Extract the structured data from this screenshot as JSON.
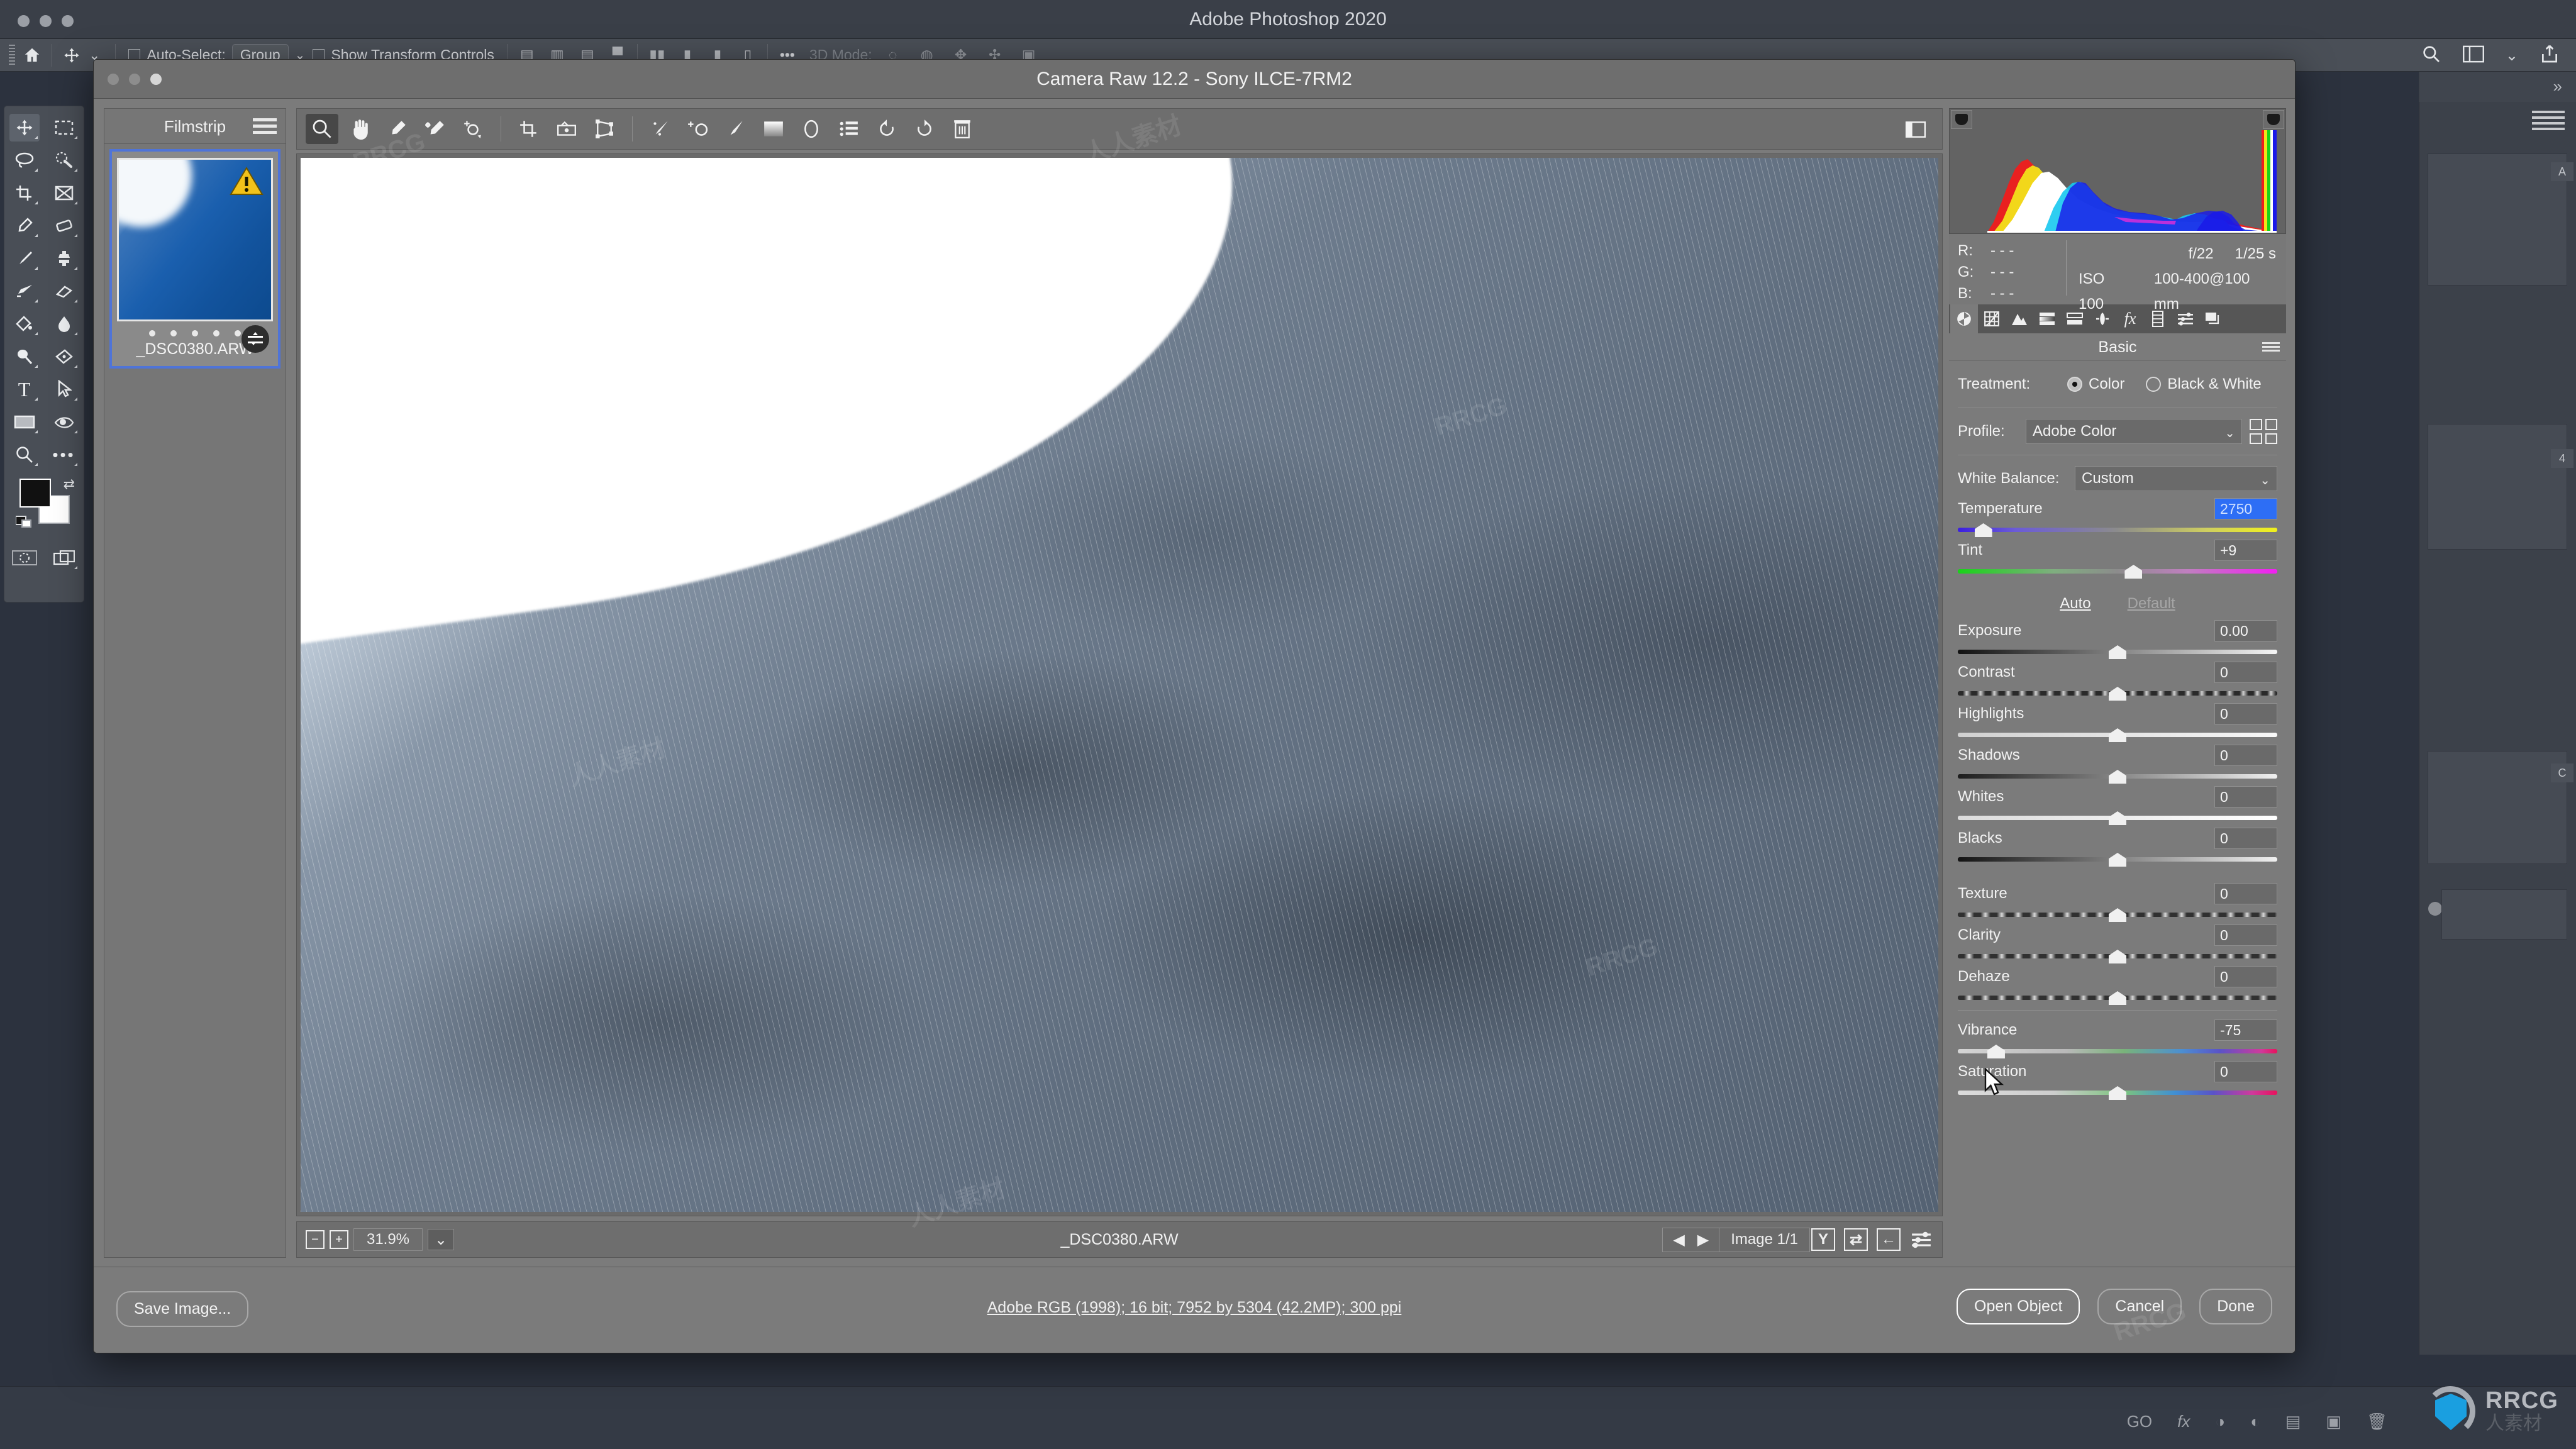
{
  "photoshop": {
    "app_title": "Adobe Photoshop 2020",
    "options_bar": {
      "home_icon": "home-icon",
      "move_tool_icon": "move-tool-icon",
      "auto_select_label": "Auto-Select:",
      "auto_select_value": "Group",
      "show_transform_label": "Show Transform Controls",
      "three_d_mode_label": "3D Mode:",
      "search_icon": "search-icon",
      "workspace_icon": "workspace-icon",
      "share_icon": "share-icon"
    },
    "toolbar": [
      {
        "icon": "move-tool-icon",
        "selected": true
      },
      {
        "icon": "marquee-tool-icon",
        "selected": false
      },
      {
        "icon": "lasso-tool-icon",
        "selected": false
      },
      {
        "icon": "quick-selection-tool-icon",
        "selected": false
      },
      {
        "icon": "crop-tool-icon",
        "selected": false
      },
      {
        "icon": "frame-tool-icon",
        "selected": false
      },
      {
        "icon": "eyedropper-tool-icon",
        "selected": false
      },
      {
        "icon": "healing-brush-tool-icon",
        "selected": false
      },
      {
        "icon": "brush-tool-icon",
        "selected": false
      },
      {
        "icon": "clone-stamp-tool-icon",
        "selected": false
      },
      {
        "icon": "history-brush-tool-icon",
        "selected": false
      },
      {
        "icon": "eraser-tool-icon",
        "selected": false
      },
      {
        "icon": "gradient-tool-icon",
        "selected": false
      },
      {
        "icon": "blur-tool-icon",
        "selected": false
      },
      {
        "icon": "dodge-tool-icon",
        "selected": false
      },
      {
        "icon": "pen-tool-icon",
        "selected": false
      },
      {
        "icon": "type-tool-icon",
        "selected": false
      },
      {
        "icon": "path-selection-tool-icon",
        "selected": false
      },
      {
        "icon": "rectangle-tool-icon",
        "selected": false
      },
      {
        "icon": "hand-tool-icon",
        "selected": false
      },
      {
        "icon": "zoom-tool-icon",
        "selected": false
      },
      {
        "icon": "edit-toolbar-icon",
        "selected": false
      },
      {
        "icon": "quick-mask-icon",
        "selected": false
      },
      {
        "icon": "screen-mode-icon",
        "selected": false
      }
    ],
    "watermark": {
      "brand": "RRCG",
      "sub": "人素材"
    }
  },
  "camera_raw": {
    "title": "Camera Raw 12.2  -  Sony ILCE-7RM2",
    "filmstrip": {
      "header": "Filmstrip",
      "menu_icon": "hamburger-menu-icon",
      "items": [
        {
          "filename": "_DSC0380.ARW",
          "warning_icon": "warning-triangle-icon",
          "badge_icon": "adjustments-badge-icon",
          "selected": true
        }
      ]
    },
    "toolbar": [
      {
        "name": "zoom-tool",
        "icon": "magnifier-icon",
        "selected": true
      },
      {
        "name": "hand-tool",
        "icon": "hand-icon",
        "selected": false
      },
      {
        "name": "white-balance-tool",
        "icon": "eyedropper-icon",
        "selected": false
      },
      {
        "name": "color-sampler-tool",
        "icon": "color-sampler-icon",
        "selected": false
      },
      {
        "name": "targeted-adjustment-tool",
        "icon": "target-adjust-icon",
        "selected": false
      },
      {
        "name": "crop-tool",
        "icon": "crop-icon",
        "selected": false
      },
      {
        "name": "straighten-tool",
        "icon": "straighten-icon",
        "selected": false
      },
      {
        "name": "transform-tool",
        "icon": "transform-icon",
        "selected": false
      },
      {
        "name": "spot-removal-tool",
        "icon": "spot-removal-icon",
        "selected": false
      },
      {
        "name": "red-eye-tool",
        "icon": "red-eye-icon",
        "selected": false
      },
      {
        "name": "adjustment-brush-tool",
        "icon": "adjustment-brush-icon",
        "selected": false
      },
      {
        "name": "graduated-filter-tool",
        "icon": "graduated-filter-icon",
        "selected": false
      },
      {
        "name": "radial-filter-tool",
        "icon": "radial-filter-icon",
        "selected": false
      },
      {
        "name": "presets-tool",
        "icon": "presets-list-icon",
        "selected": false
      },
      {
        "name": "rotate-ccw-tool",
        "icon": "rotate-counterclockwise-icon",
        "selected": false
      },
      {
        "name": "rotate-cw-tool",
        "icon": "rotate-clockwise-icon",
        "selected": false
      },
      {
        "name": "delete-tool",
        "icon": "trash-icon",
        "selected": false
      }
    ],
    "toolbar_right_icon": "fullscreen-toggle-icon",
    "status_bar": {
      "zoom_out_label": "−",
      "zoom_in_label": "+",
      "zoom_value": "31.9%",
      "zoom_caret_icon": "chevron-down-icon",
      "filename": "_DSC0380.ARW",
      "prev_icon": "prev-arrow-icon",
      "next_icon": "next-arrow-icon",
      "image_counter": "Image 1/1",
      "icons": [
        {
          "name": "before-after-icon",
          "glyph": "Y"
        },
        {
          "name": "swap-before-after-icon",
          "glyph": "⇄"
        },
        {
          "name": "copy-settings-icon",
          "glyph": "←"
        },
        {
          "name": "preview-preferences-icon",
          "glyph": "sliders"
        }
      ]
    },
    "histogram": {
      "shadow_clip_icon": "shadow-clipping-icon",
      "highlight_clip_icon": "highlight-clipping-icon"
    },
    "exif": {
      "r_label": "R:",
      "r_value": "- - -",
      "g_label": "G:",
      "g_value": "- - -",
      "b_label": "B:",
      "b_value": "- - -",
      "aperture": "f/22",
      "shutter": "1/25 s",
      "iso": "ISO 100",
      "lens": "100-400@100 mm"
    },
    "panel_tabs": [
      {
        "name": "basic-tab",
        "icon": "aperture-icon",
        "selected": true
      },
      {
        "name": "tone-curve-tab",
        "icon": "curve-grid-icon",
        "selected": false
      },
      {
        "name": "detail-tab",
        "icon": "mountains-icon",
        "selected": false
      },
      {
        "name": "color-mixer-tab",
        "icon": "gradient-bars-icon",
        "selected": false
      },
      {
        "name": "color-grading-tab",
        "icon": "split-tone-icon",
        "selected": false
      },
      {
        "name": "optics-tab",
        "icon": "lens-icon",
        "selected": false
      },
      {
        "name": "effects-tab",
        "icon": "fx-icon",
        "selected": false
      },
      {
        "name": "calibration-tab",
        "icon": "filmstrip-icon",
        "selected": false
      },
      {
        "name": "presets-tab",
        "icon": "sliders-icon",
        "selected": false
      },
      {
        "name": "snapshots-tab",
        "icon": "stacked-layers-icon",
        "selected": false
      }
    ],
    "panel_title": "Basic",
    "panel_menu_icon": "panel-menu-icon",
    "basic": {
      "treatment_label": "Treatment:",
      "treatment_options": [
        {
          "label": "Color",
          "selected": true
        },
        {
          "label": "Black & White",
          "selected": false
        }
      ],
      "profile_label": "Profile:",
      "profile_value": "Adobe Color",
      "profile_browse_icon": "profile-browser-icon",
      "white_balance_label": "White Balance:",
      "white_balance_value": "Custom",
      "auto_label": "Auto",
      "default_label": "Default",
      "sliders": [
        {
          "name": "Temperature",
          "value": "2750",
          "pos": 8,
          "bar": "temp",
          "selected": true
        },
        {
          "name": "Tint",
          "value": "+9",
          "pos": 55,
          "bar": "tint",
          "selected": false
        },
        {
          "name": "Exposure",
          "value": "0.00",
          "pos": 50,
          "bar": "exp",
          "selected": false
        },
        {
          "name": "Contrast",
          "value": "0",
          "pos": 50,
          "bar": "contrast",
          "selected": false
        },
        {
          "name": "Highlights",
          "value": "0",
          "pos": 50,
          "bar": "hl",
          "selected": false
        },
        {
          "name": "Shadows",
          "value": "0",
          "pos": 50,
          "bar": "sh",
          "selected": false
        },
        {
          "name": "Whites",
          "value": "0",
          "pos": 50,
          "bar": "wh",
          "selected": false
        },
        {
          "name": "Blacks",
          "value": "0",
          "pos": 50,
          "bar": "bl",
          "selected": false
        },
        {
          "name": "Texture",
          "value": "0",
          "pos": 50,
          "bar": "tex",
          "selected": false
        },
        {
          "name": "Clarity",
          "value": "0",
          "pos": 50,
          "bar": "tex",
          "selected": false
        },
        {
          "name": "Dehaze",
          "value": "0",
          "pos": 50,
          "bar": "tex",
          "selected": false
        },
        {
          "name": "Vibrance",
          "value": "-75",
          "pos": 12,
          "bar": "vib",
          "selected": false
        },
        {
          "name": "Saturation",
          "value": "0",
          "pos": 50,
          "bar": "sat",
          "selected": false
        }
      ]
    },
    "footer": {
      "save_image_label": "Save Image...",
      "workflow_link": "Adobe RGB (1998); 16 bit; 7952 by 5304 (42.2MP); 300 ppi",
      "open_object_label": "Open Object",
      "cancel_label": "Cancel",
      "done_label": "Done"
    }
  }
}
